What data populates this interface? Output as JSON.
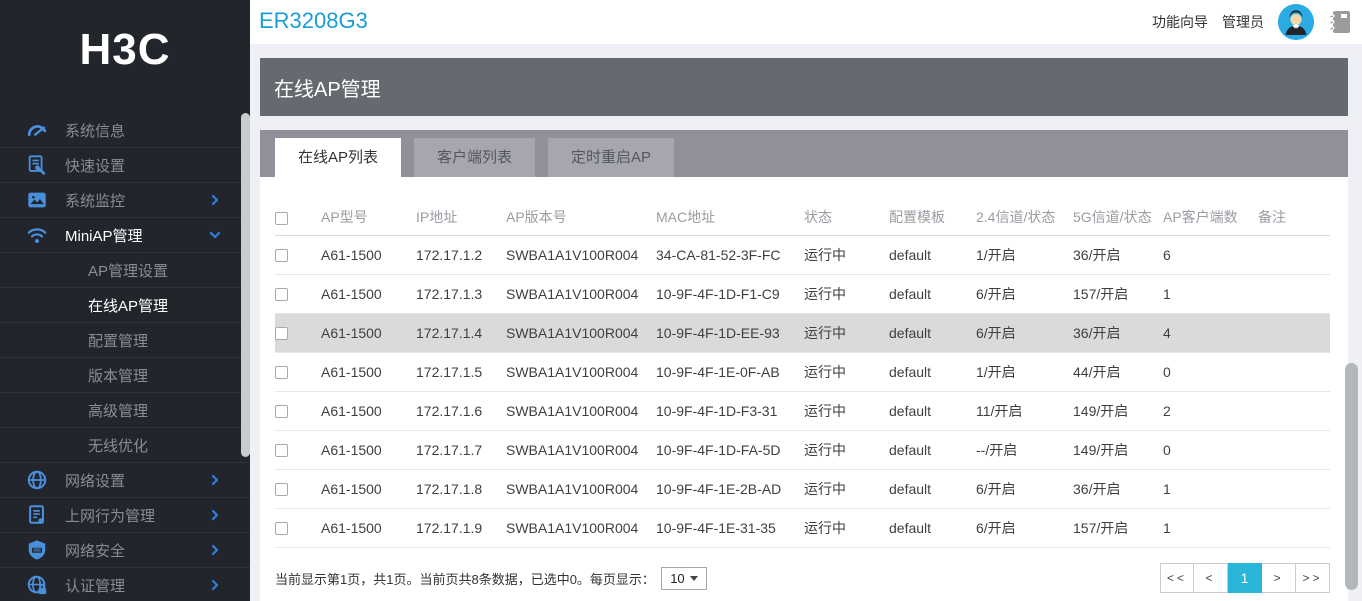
{
  "brand": {
    "logo": "H3C"
  },
  "topbar": {
    "device_name": "ER3208G3",
    "wizard_label": "功能向导",
    "user_label": "管理员",
    "avatar_icon": "user-avatar-icon",
    "log_icon": "logbook-icon"
  },
  "sidebar": {
    "items": [
      {
        "name": "system-info",
        "label": "系统信息",
        "icon": "gauge-icon"
      },
      {
        "name": "quick-setup",
        "label": "快速设置",
        "icon": "quick-setup-icon"
      },
      {
        "name": "system-monitor",
        "label": "系统监控",
        "icon": "monitor-icon",
        "chevron": "right"
      },
      {
        "name": "miniap-management",
        "label": "MiniAP管理",
        "icon": "wifi-icon",
        "chevron": "down",
        "active": true
      },
      {
        "name": "ap-management-settings",
        "label": "AP管理设置",
        "sub": true
      },
      {
        "name": "online-ap-management",
        "label": "在线AP管理",
        "sub": true,
        "active": true
      },
      {
        "name": "config-management",
        "label": "配置管理",
        "sub": true
      },
      {
        "name": "version-management",
        "label": "版本管理",
        "sub": true
      },
      {
        "name": "advanced-management",
        "label": "高级管理",
        "sub": true
      },
      {
        "name": "wireless-optimization",
        "label": "无线优化",
        "sub": true
      },
      {
        "name": "network-settings",
        "label": "网络设置",
        "icon": "globe-icon",
        "chevron": "right"
      },
      {
        "name": "behavior-management",
        "label": "上网行为管理",
        "icon": "behavior-icon",
        "chevron": "right"
      },
      {
        "name": "network-security",
        "label": "网络安全",
        "icon": "shield-icon",
        "chevron": "right"
      },
      {
        "name": "auth-management",
        "label": "认证管理",
        "icon": "auth-globe-icon",
        "chevron": "right"
      }
    ]
  },
  "page": {
    "title": "在线AP管理"
  },
  "tabs": [
    {
      "name": "online-ap-list",
      "label": "在线AP列表",
      "active": true
    },
    {
      "name": "client-list",
      "label": "客户端列表",
      "active": false
    },
    {
      "name": "scheduled-reboot-ap",
      "label": "定时重启AP",
      "active": false
    }
  ],
  "table": {
    "columns": [
      "AP型号",
      "IP地址",
      "AP版本号",
      "MAC地址",
      "状态",
      "配置模板",
      "2.4信道/状态",
      "5G信道/状态",
      "AP客户端数",
      "备注"
    ],
    "rows": [
      {
        "model": "A61-1500",
        "ip": "172.17.1.2",
        "version": "SWBA1A1V100R004",
        "mac": "34-CA-81-52-3F-FC",
        "status": "运行中",
        "template": "default",
        "ch24": "1/开启",
        "ch5": "36/开启",
        "clients": "6",
        "note": "",
        "highlighted": false
      },
      {
        "model": "A61-1500",
        "ip": "172.17.1.3",
        "version": "SWBA1A1V100R004",
        "mac": "10-9F-4F-1D-F1-C9",
        "status": "运行中",
        "template": "default",
        "ch24": "6/开启",
        "ch5": "157/开启",
        "clients": "1",
        "note": "",
        "highlighted": false
      },
      {
        "model": "A61-1500",
        "ip": "172.17.1.4",
        "version": "SWBA1A1V100R004",
        "mac": "10-9F-4F-1D-EE-93",
        "status": "运行中",
        "template": "default",
        "ch24": "6/开启",
        "ch5": "36/开启",
        "clients": "4",
        "note": "",
        "highlighted": true
      },
      {
        "model": "A61-1500",
        "ip": "172.17.1.5",
        "version": "SWBA1A1V100R004",
        "mac": "10-9F-4F-1E-0F-AB",
        "status": "运行中",
        "template": "default",
        "ch24": "1/开启",
        "ch5": "44/开启",
        "clients": "0",
        "note": "",
        "highlighted": false
      },
      {
        "model": "A61-1500",
        "ip": "172.17.1.6",
        "version": "SWBA1A1V100R004",
        "mac": "10-9F-4F-1D-F3-31",
        "status": "运行中",
        "template": "default",
        "ch24": "11/开启",
        "ch5": "149/开启",
        "clients": "2",
        "note": "",
        "highlighted": false
      },
      {
        "model": "A61-1500",
        "ip": "172.17.1.7",
        "version": "SWBA1A1V100R004",
        "mac": "10-9F-4F-1D-FA-5D",
        "status": "运行中",
        "template": "default",
        "ch24": "--/开启",
        "ch5": "149/开启",
        "clients": "0",
        "note": "",
        "highlighted": false
      },
      {
        "model": "A61-1500",
        "ip": "172.17.1.8",
        "version": "SWBA1A1V100R004",
        "mac": "10-9F-4F-1E-2B-AD",
        "status": "运行中",
        "template": "default",
        "ch24": "6/开启",
        "ch5": "36/开启",
        "clients": "1",
        "note": "",
        "highlighted": false
      },
      {
        "model": "A61-1500",
        "ip": "172.17.1.9",
        "version": "SWBA1A1V100R004",
        "mac": "10-9F-4F-1E-31-35",
        "status": "运行中",
        "template": "default",
        "ch24": "6/开启",
        "ch5": "157/开启",
        "clients": "1",
        "note": "",
        "highlighted": false
      }
    ]
  },
  "footer": {
    "summary": "当前显示第1页，共1页。当前页共8条数据，已选中0。每页显示：",
    "page_size": "10"
  },
  "pagination": {
    "buttons": [
      "<<",
      "<",
      "1",
      ">",
      ">>"
    ],
    "active_index": 2
  },
  "colors": {
    "accent_blue": "#1a9cd8",
    "icon_blue": "#4a8fdc",
    "banner_gray": "#66696f",
    "tabstrip_gray": "#8f909a",
    "row_highlight": "#dadada",
    "active_page_bg": "#29b5d8",
    "sidebar_bg": "#22262c",
    "avatar_bg": "#2aabe3"
  }
}
